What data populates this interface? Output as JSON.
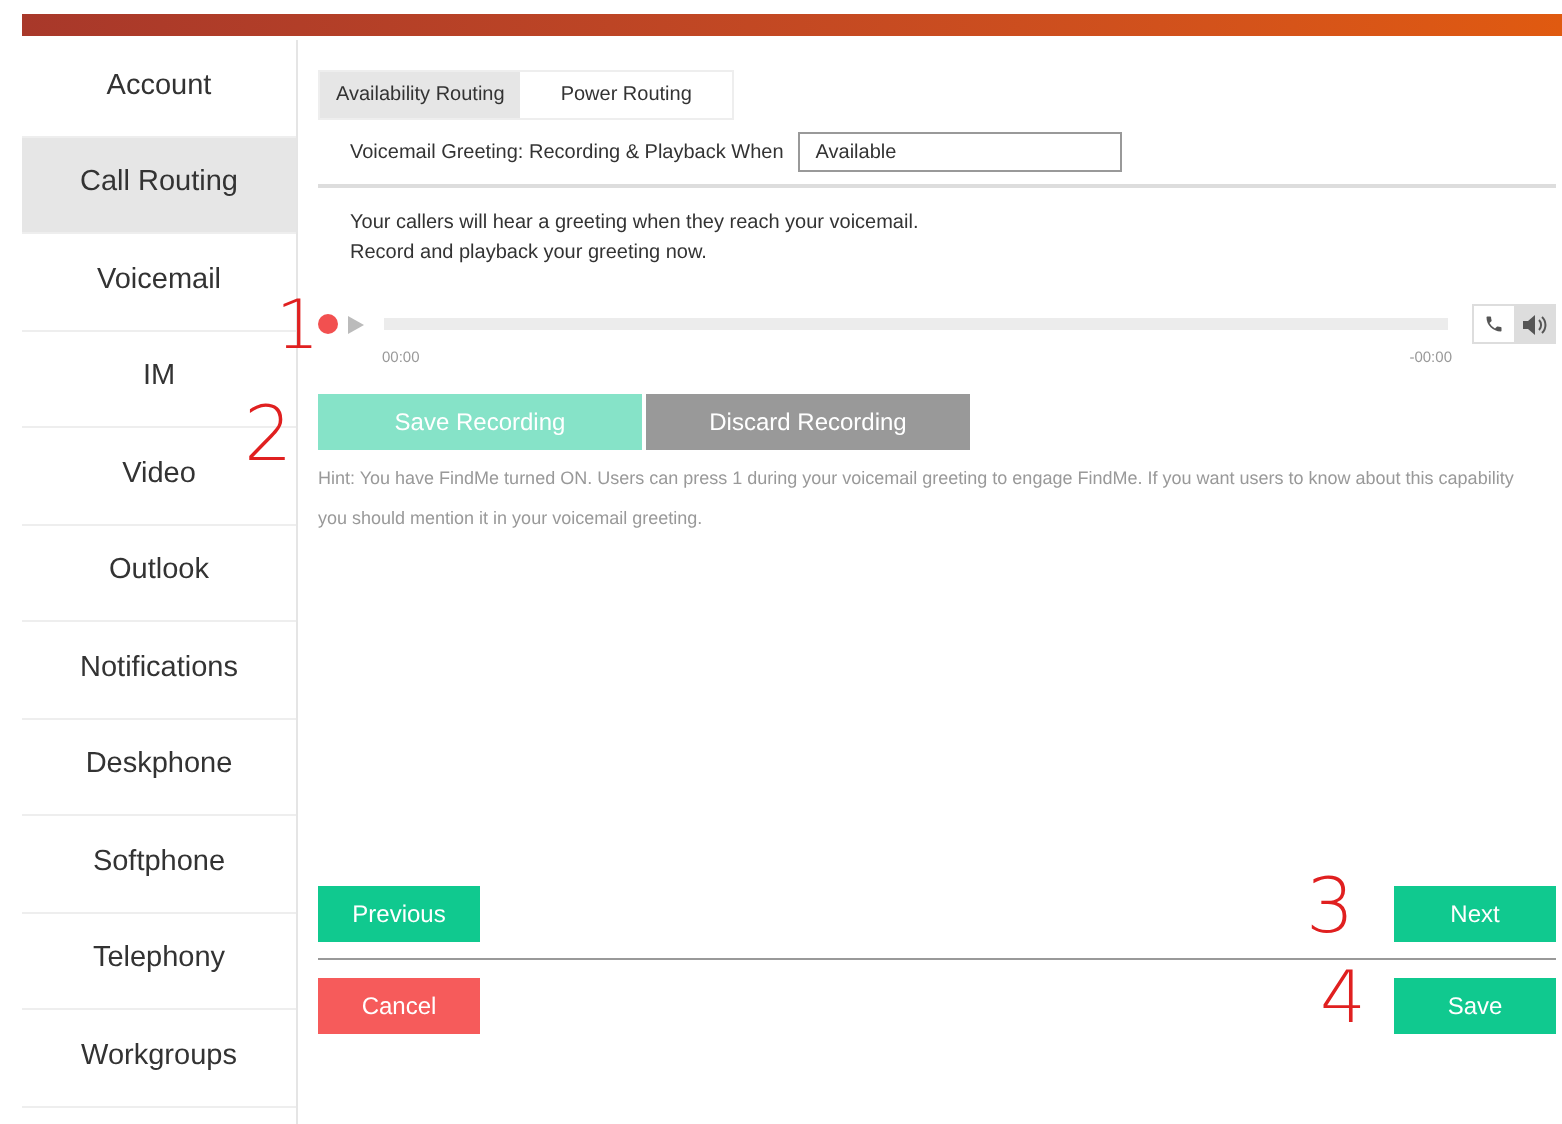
{
  "sidebar": {
    "items": [
      {
        "label": "Account",
        "selected": false
      },
      {
        "label": "Call Routing",
        "selected": true
      },
      {
        "label": "Voicemail",
        "selected": false
      },
      {
        "label": "IM",
        "selected": false
      },
      {
        "label": "Video",
        "selected": false
      },
      {
        "label": "Outlook",
        "selected": false
      },
      {
        "label": "Notifications",
        "selected": false
      },
      {
        "label": "Deskphone",
        "selected": false
      },
      {
        "label": "Softphone",
        "selected": false
      },
      {
        "label": "Telephony",
        "selected": false
      },
      {
        "label": "Workgroups",
        "selected": false
      }
    ]
  },
  "tabs": [
    {
      "label": "Availability Routing",
      "selected": true
    },
    {
      "label": "Power Routing",
      "selected": false
    }
  ],
  "greeting_field": {
    "label": "Voicemail Greeting: Recording & Playback When",
    "value": "Available"
  },
  "intro": [
    "Your callers will hear a greeting when they reach your voicemail.",
    "Record and playback your greeting now."
  ],
  "player": {
    "elapsed": "00:00",
    "remaining": "-00:00",
    "speaker_selected": true
  },
  "record_buttons": [
    {
      "label": "Save Recording",
      "kind": "save",
      "disabled": true
    },
    {
      "label": "Discard Recording",
      "kind": "discard",
      "disabled": false
    }
  ],
  "hint": "Hint: You have FindMe turned ON. Users can press 1 during your voicemail greeting to engage FindMe. If you want users to know about this capability you should mention it in your voicemail greeting.",
  "nav": {
    "previous": "Previous",
    "next": "Next",
    "cancel": "Cancel",
    "save": "Save"
  },
  "annotations": [
    "1",
    "2",
    "3",
    "4"
  ]
}
